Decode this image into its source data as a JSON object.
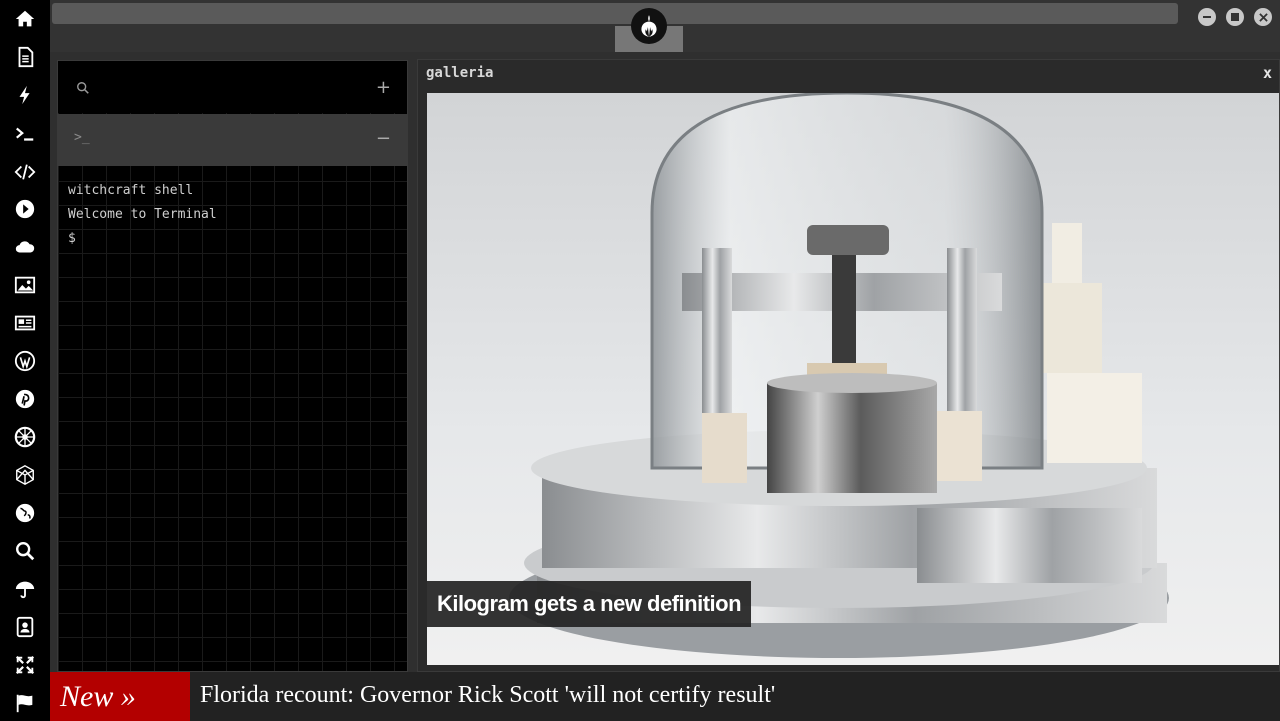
{
  "sidebar": {
    "items": [
      {
        "icon": "home-icon"
      },
      {
        "icon": "document-icon"
      },
      {
        "icon": "lightning-icon"
      },
      {
        "icon": "terminal-icon"
      },
      {
        "icon": "code-icon"
      },
      {
        "icon": "play-icon"
      },
      {
        "icon": "cloud-icon"
      },
      {
        "icon": "image-icon"
      },
      {
        "icon": "newspaper-icon"
      },
      {
        "icon": "wordpress-icon"
      },
      {
        "icon": "pinterest-icon"
      },
      {
        "icon": "empire-icon"
      },
      {
        "icon": "polyhedron-icon"
      },
      {
        "icon": "globe-icon"
      },
      {
        "icon": "search-icon"
      },
      {
        "icon": "umbrella-icon"
      },
      {
        "icon": "contact-book-icon"
      },
      {
        "icon": "expand-icon"
      },
      {
        "icon": "flag-icon"
      }
    ]
  },
  "window_controls": [
    "minimize-icon",
    "maximize-icon",
    "close-icon"
  ],
  "logo": {
    "icon": "rebel-alliance-icon"
  },
  "terminal": {
    "search_icon": "search-icon",
    "add_label": "+",
    "tab_prompt": ">_",
    "collapse_label": "−",
    "lines": [
      "witchcraft shell",
      "Welcome to Terminal",
      "$"
    ]
  },
  "gallery": {
    "title": "galleria",
    "close_label": "x",
    "caption": "Kilogram gets a new definition"
  },
  "ticker": {
    "label": "New »",
    "headline": "Florida recount: Governor Rick Scott 'will not certify result'",
    "label_color": "#b30000"
  }
}
